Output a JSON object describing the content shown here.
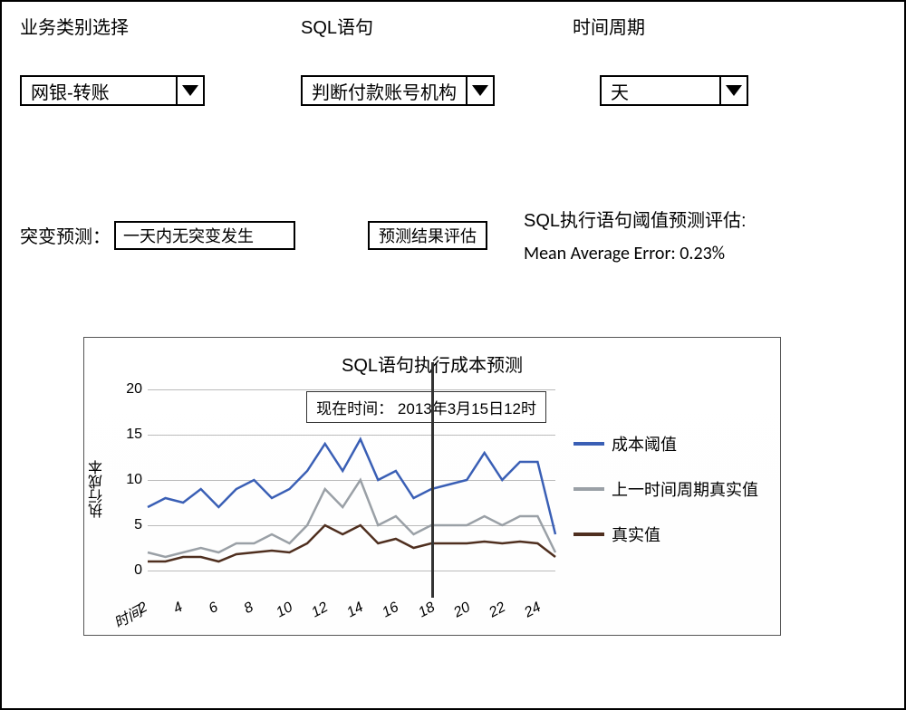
{
  "labels": {
    "biz": "业务类别选择",
    "sql": "SQL语句",
    "period": "时间周期"
  },
  "selects": {
    "biz": "网银-转账",
    "sql": "判断付款账号机构",
    "period": "天"
  },
  "mutation": {
    "label": "突变预测：",
    "value": "一天内无突变发生"
  },
  "evalBtn": "预测结果评估",
  "eval": {
    "title": "SQL执行语句阈值预测评估:",
    "error": "Mean Average Error: 0.23%"
  },
  "chart_data": {
    "type": "line",
    "title": "SQL语句执行成本预测",
    "ylabel": "执行成本",
    "xlabel": "",
    "ylim": [
      0,
      20
    ],
    "yticks": [
      0,
      5,
      10,
      15,
      20
    ],
    "categories": [
      "时间",
      2,
      4,
      6,
      8,
      10,
      12,
      14,
      16,
      18,
      20,
      22,
      24
    ],
    "x": [
      1,
      2,
      3,
      4,
      5,
      6,
      7,
      8,
      9,
      10,
      11,
      12,
      13,
      14,
      15,
      16,
      17,
      18,
      19,
      20,
      21,
      22,
      23,
      24
    ],
    "now_x": 17,
    "now_label": "现在时间：",
    "now_value": "2013年3月15日12时",
    "series": [
      {
        "name": "成本阈值",
        "color": "#3a5fb5",
        "values": [
          7,
          8,
          7.5,
          9,
          7,
          9,
          10,
          8,
          9,
          11,
          14,
          11,
          14.5,
          10,
          11,
          8,
          9,
          9.5,
          10,
          13,
          10,
          12,
          12,
          4
        ]
      },
      {
        "name": "上一时间周期真实值",
        "color": "#9aa0a6",
        "values": [
          2,
          1.5,
          2,
          2.5,
          2,
          3,
          3,
          4,
          3,
          5,
          9,
          7,
          10,
          5,
          6,
          4,
          5,
          5,
          5,
          6,
          5,
          6,
          6,
          2
        ]
      },
      {
        "name": "真实值",
        "color": "#4f2f1f",
        "values": [
          1,
          1,
          1.5,
          1.5,
          1,
          1.8,
          2,
          2.2,
          2,
          3,
          5,
          4,
          5,
          3,
          3.5,
          2.5,
          3,
          3,
          3,
          3.2,
          3,
          3.2,
          3,
          1.5
        ]
      }
    ]
  }
}
